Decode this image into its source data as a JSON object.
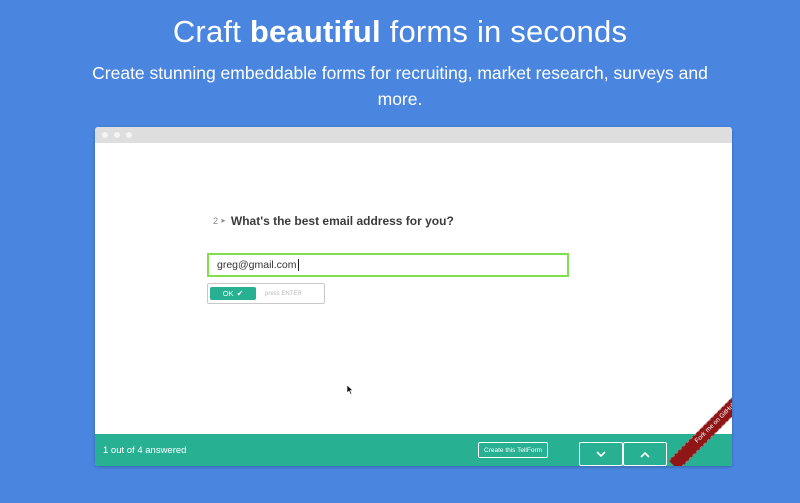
{
  "hero": {
    "headline_pre": "Craft ",
    "headline_bold": "beautiful",
    "headline_post": " forms in seconds",
    "subtitle": "Create stunning embeddable forms for recruiting, market research, surveys and more."
  },
  "colors": {
    "page_background": "#4a86e0",
    "accent": "#27b092",
    "input_focus_border": "#7ee04f",
    "ribbon": "#8f1616"
  },
  "form": {
    "question_number": "2",
    "question_text": "What's the best email address for you?",
    "email_value": "greg@gmail.com",
    "ok_label": "OK",
    "enter_hint": "press ENTER"
  },
  "footer": {
    "progress": "1 out of 4 answered",
    "create_label": "Create this TellForm",
    "down_icon": "chevron-down-icon",
    "up_icon": "chevron-up-icon"
  },
  "ribbon": {
    "label": "Fork me on GitHub"
  }
}
